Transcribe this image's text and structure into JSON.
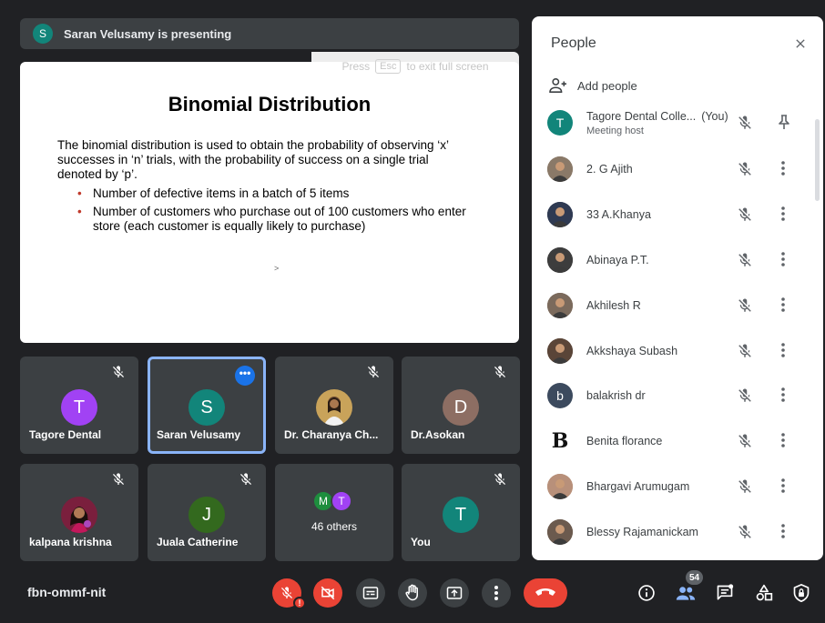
{
  "presenter": {
    "initial": "S",
    "text": "Saran Velusamy is presenting",
    "avatar_color": "#12857a"
  },
  "fullscreen_hint": {
    "before": "Press",
    "key": "Esc",
    "after": "to exit full screen"
  },
  "slide": {
    "title": "Binomial Distribution",
    "paragraph": "The binomial distribution is used to obtain the probability of observing ‘x’ successes in ‘n’ trials, with the probability of success on a single trial denoted by ‘p’.",
    "bullets": [
      "Number of defective items in a batch of 5 items",
      "Number of customers who purchase out of 100 customers who enter store (each customer is equally likely to purchase)"
    ],
    "cursor": ">"
  },
  "tiles": [
    {
      "name": "Tagore Dental",
      "initial": "T",
      "color": "#a142f4",
      "muted": true
    },
    {
      "name": "Saran Velusamy",
      "initial": "S",
      "color": "#12857a",
      "active": true,
      "more_label": "•••"
    },
    {
      "name": "Dr. Charanya Ch...",
      "photo": true,
      "muted": true
    },
    {
      "name": "Dr.Asokan",
      "initial": "D",
      "color": "#8d6e63",
      "muted": true
    },
    {
      "name": "kalpana krishna",
      "photo": true,
      "muted": true
    },
    {
      "name": "Juala Catherine",
      "initial": "J",
      "color": "#33691e",
      "muted": true
    },
    {
      "others": true,
      "label": "46 others",
      "initials": [
        "M",
        "T"
      ],
      "colors": [
        "#1e8e3e",
        "#a142f4"
      ]
    },
    {
      "name": "You",
      "initial": "T",
      "color": "#12857a",
      "muted": true
    }
  ],
  "people_panel": {
    "title": "People",
    "add_people": "Add people",
    "people": [
      {
        "name": "Tagore Dental Colle...",
        "you": "(You)",
        "subtitle": "Meeting host",
        "initial": "T",
        "color": "#12857a",
        "host": true
      },
      {
        "name": "2. G Ajith",
        "photo": true,
        "color": "#8a7968"
      },
      {
        "name": "33 A.Khanya",
        "photo": true,
        "color": "#2f3a52"
      },
      {
        "name": "Abinaya P.T.",
        "photo": true,
        "color": "#3d3d3d"
      },
      {
        "name": "Akhilesh R",
        "photo": true,
        "color": "#7b6a5c"
      },
      {
        "name": "Akkshaya Subash",
        "photo": true,
        "color": "#5a4538"
      },
      {
        "name": "balakrish dr",
        "initial": "b",
        "color": "#3c4a5e"
      },
      {
        "name": "Benita florance",
        "letter_logo": "B",
        "color": "#ffffff"
      },
      {
        "name": "Bhargavi Arumugam",
        "photo": true,
        "color": "#b8907a"
      },
      {
        "name": "Blessy Rajamanickam",
        "photo": true,
        "color": "#6b5a4e"
      }
    ]
  },
  "bottom_bar": {
    "meeting_code": "fbn-ommf-nit",
    "mic_alert": "!",
    "participant_count": "54"
  },
  "colors": {
    "background": "#202124",
    "tile": "#3c4043",
    "accent": "#8ab4f8",
    "danger": "#ea4335"
  }
}
